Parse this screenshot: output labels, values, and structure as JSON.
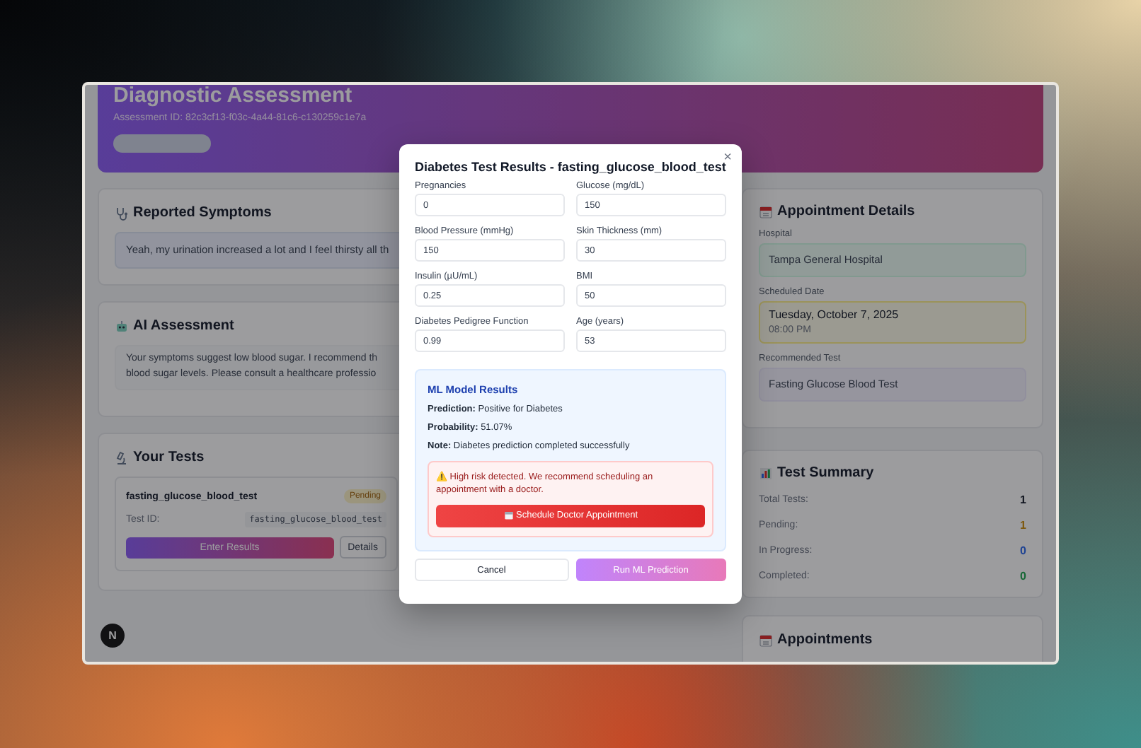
{
  "header": {
    "title": "Diagnostic Assessment",
    "assessment_id": "Assessment ID: 82c3cf13-f03c-4a44-81c6-c130259c1e7a"
  },
  "symptoms": {
    "title": "Reported Symptoms",
    "text": "Yeah, my urination increased a lot and I feel thirsty all th"
  },
  "ai_assessment": {
    "title": "AI Assessment",
    "lines": [
      "Your symptoms suggest low blood sugar. I recommend th",
      "blood sugar levels. Please consult a healthcare professio"
    ]
  },
  "tests": {
    "title": "Your Tests",
    "items": [
      {
        "name": "fasting_glucose_blood_test",
        "status": "Pending",
        "id_label": "Test ID:",
        "id_value": "fasting_glucose_blood_test",
        "primary_action": "Enter Results",
        "secondary_action": "Details"
      }
    ]
  },
  "appointment": {
    "title": "Appointment Details",
    "hospital_label": "Hospital",
    "hospital": "Tampa General Hospital",
    "date_label": "Scheduled Date",
    "date": "Tuesday, October 7, 2025",
    "time": "08:00 PM",
    "test_label": "Recommended Test",
    "test": "Fasting Glucose Blood Test"
  },
  "summary": {
    "title": "Test Summary",
    "rows": [
      {
        "label": "Total Tests:",
        "value": "1",
        "color": "#121621"
      },
      {
        "label": "Pending:",
        "value": "1",
        "color": "#7e580d"
      },
      {
        "label": "In Progress:",
        "value": "0",
        "color": "#1e4293"
      },
      {
        "label": "Completed:",
        "value": "0",
        "color": "#156735"
      }
    ]
  },
  "appointments": {
    "title": "Appointments"
  },
  "dev_badge": "N",
  "modal": {
    "title": "Diabetes Test Results - fasting_glucose_blood_test",
    "close": "×",
    "fields": [
      {
        "label": "Pregnancies",
        "value": "0"
      },
      {
        "label": "Glucose (mg/dL)",
        "value": "150"
      },
      {
        "label": "Blood Pressure (mmHg)",
        "value": "150"
      },
      {
        "label": "Skin Thickness (mm)",
        "value": "30"
      },
      {
        "label": "Insulin (µU/mL)",
        "value": "0.25"
      },
      {
        "label": "BMI",
        "value": "50"
      },
      {
        "label": "Diabetes Pedigree Function",
        "value": "0.99"
      },
      {
        "label": "Age (years)",
        "value": "53"
      }
    ],
    "results": {
      "title": "ML Model Results",
      "lines": [
        "**Prediction:** Positive for Diabetes",
        "**Probability:** 51.07%",
        "**Note:** Diabetes prediction completed successfully"
      ],
      "warning": "⚠️ High risk detected. We recommend scheduling an appointment with a doctor.",
      "warning_action": "Schedule Doctor Appointment"
    },
    "cancel": "Cancel",
    "submit": "Run ML Prediction"
  }
}
